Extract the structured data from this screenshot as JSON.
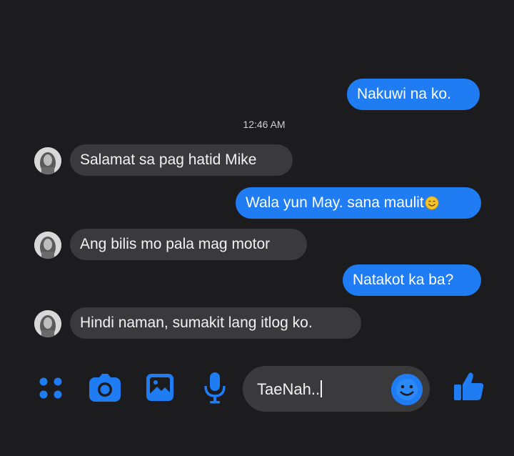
{
  "messages": [
    {
      "direction": "outgoing",
      "text": "Nakuwi na ko."
    },
    {
      "direction": "timestamp",
      "text": "12:46 AM"
    },
    {
      "direction": "incoming",
      "text": "Salamat sa pag hatid Mike"
    },
    {
      "direction": "outgoing",
      "text": "Wala yun May. sana maulit",
      "emoji": "smiling-face-icon"
    },
    {
      "direction": "incoming",
      "text": "Ang bilis mo pala mag motor"
    },
    {
      "direction": "outgoing",
      "text": "Natakot ka ba?"
    },
    {
      "direction": "incoming",
      "text": "Hindi naman, sumakit lang itlog ko."
    }
  ],
  "composer": {
    "text": "TaeNah..",
    "icons": [
      "apps-grid-icon",
      "camera-icon",
      "gallery-icon",
      "microphone-icon",
      "emoji-icon",
      "thumbs-up-icon"
    ]
  },
  "colors": {
    "background": "#1c1c1e",
    "outgoing_bubble": "#1f7cf2",
    "incoming_bubble": "#3a3a3c",
    "accent": "#1f7cf2"
  }
}
